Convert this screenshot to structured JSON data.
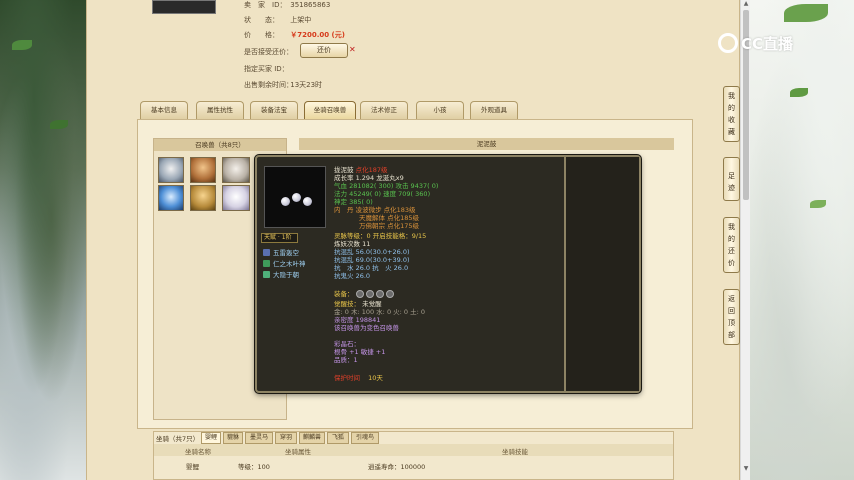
{
  "seller_info": {
    "seller_label": "卖　家　ID：",
    "seller_value": "351865863",
    "status_label": "状　　态：",
    "status_value": "上架中",
    "price_label": "价　　格：",
    "price_value": "￥7200.00 (元)",
    "offer_label": "是否接受还价：",
    "offer_button": "还价",
    "buyer_label": "指定买家 ID：",
    "buyer_value": "",
    "remaining_label": "出售剩余时间：",
    "remaining_value": "13天23时"
  },
  "tabs": [
    {
      "label": "基本信息"
    },
    {
      "label": "属性抗性"
    },
    {
      "label": "装备法宝"
    },
    {
      "label": "坐骑召唤兽"
    },
    {
      "label": "法术修正"
    },
    {
      "label": "小孩"
    },
    {
      "label": "外观道具"
    }
  ],
  "pet_panel": {
    "title": "召唤兽（共8只）",
    "detail_title": "泥泥鼓"
  },
  "tooltip": {
    "tier_badge": "天赋 · 1阶",
    "skills": [
      "五雷轰空",
      "仁之木叶神",
      "大隐于朝"
    ],
    "name_label": "拢泥鼓",
    "name_tag": "点化187级",
    "growth": "成长率 1.294 龙涎丸x9",
    "hp": "气血 281082( 300) 攻击 9437( 0)",
    "mp": "法力 45249( 0) 速度 709( 360)",
    "fixed": "神定 385( 0)",
    "inner_1": "内　丹  凌波微步 点化183级",
    "inner_2": "天魔解体 点化185级",
    "inner_3": "万佛朝宗 点化175级",
    "spirit": "灵脉等级：0  开启技能格：9/15",
    "attack_times": "炼妖次数 11",
    "res_1": "抗混乱 56.0(30.0+26.0)",
    "res_2": "抗混乱 69.0(30.0+39.0)",
    "res_3": "抗　水 26.0 抗　火 26.0",
    "res_4": "抗鬼火 26.0",
    "equip_label": "装备：",
    "awaken_label": "觉醒技：",
    "awaken_value": "未觉醒",
    "elements": "金: 0 木: 100 水: 0 火: 0 土: 0",
    "intimacy": "亲密度 198841",
    "transform_note": "该召唤兽为变色召唤兽",
    "color_stone_label": "彩晶石：",
    "color_stone_1": "根骨 +1 敏捷 +1",
    "color_stone_2": "品质：1",
    "protect_label": "保护时间",
    "protect_value": "10天"
  },
  "mount_section": {
    "title": "坐骑（共7只）",
    "tabs": [
      "婴鲤",
      "貔貅",
      "墨灵马",
      "穿羽",
      "麒麟兽",
      "飞狐",
      "引魂鸟"
    ],
    "col_1": "坐骑名称",
    "col_2": "坐骑属性",
    "col_3": "坐骑技能",
    "row_name": "婴鲤",
    "row_level": "等级：100",
    "row_skill": "逍遥寿命：100000"
  },
  "side_nav": {
    "collection": [
      "我",
      "的",
      "收",
      "藏"
    ],
    "footprint": [
      "足",
      "迹"
    ],
    "my_offers": [
      "我",
      "的",
      "还",
      "价"
    ],
    "back_top": [
      "返",
      "回",
      "顶",
      "部"
    ]
  },
  "logo": {
    "text": "CC直播"
  },
  "colors": {
    "parchment": "#efe3c4",
    "tooltip_bg": "#2c2a22",
    "price_red": "#d63b1c",
    "skill_blue": "#9fd0f2"
  }
}
